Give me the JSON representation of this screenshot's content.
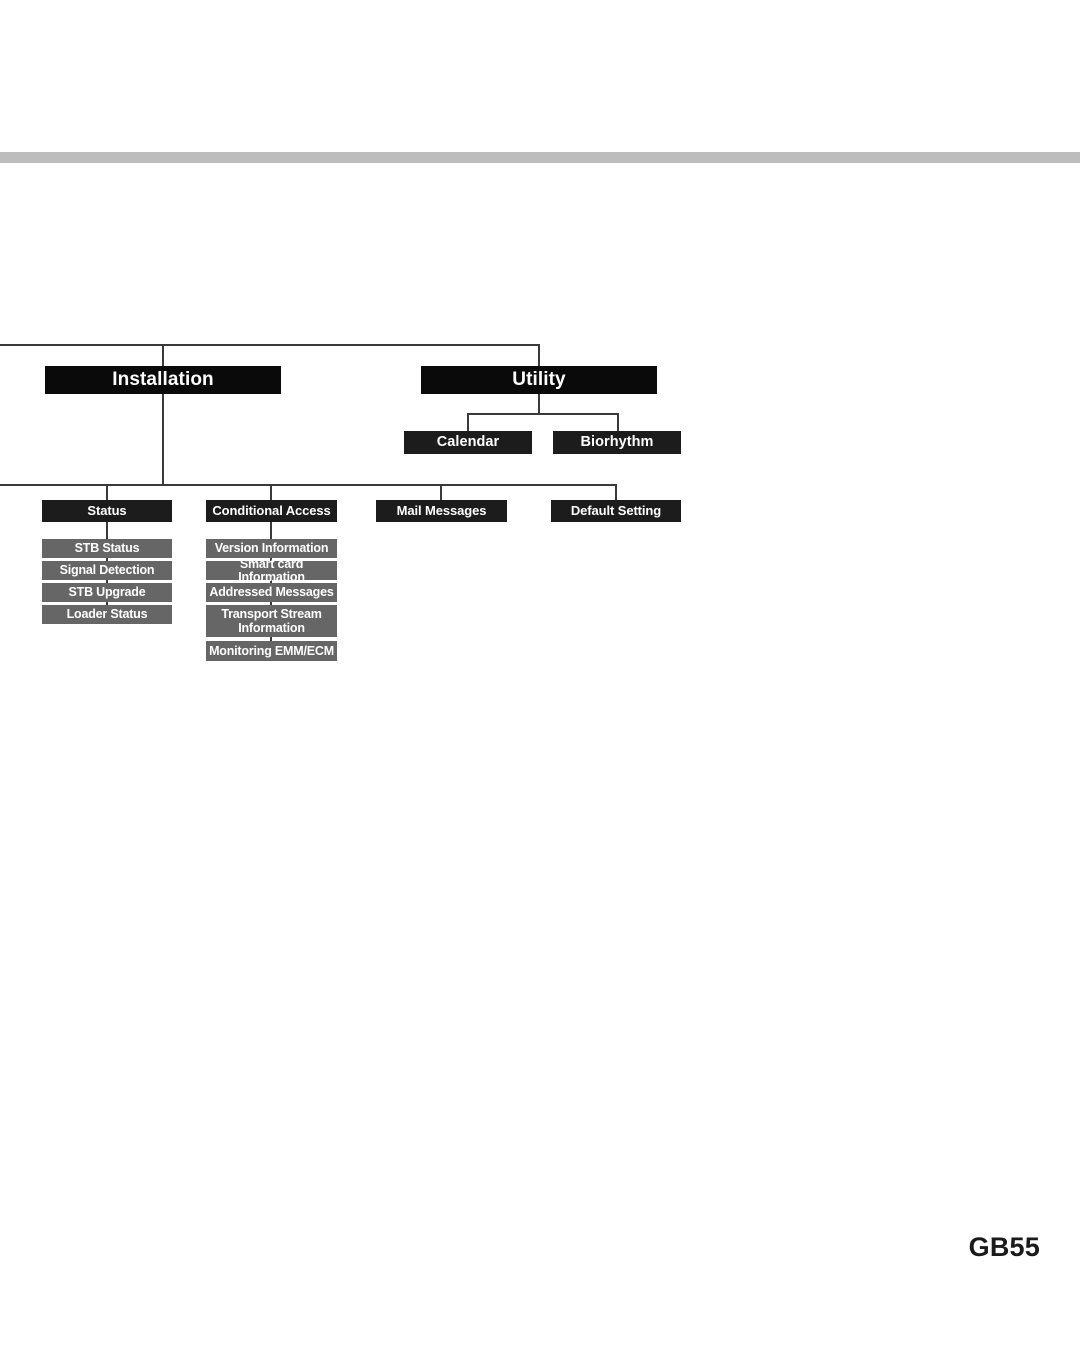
{
  "page": {
    "page_number": "GB55"
  },
  "diagram": {
    "type": "menu-tree",
    "colors": {
      "level1_box": "#0a0a0a",
      "sub_box": "#1c1c1c",
      "leaf_box": "#666666",
      "connector": "#3a3a3a",
      "header_rule": "#bdbdbd",
      "label_text": "#ffffff"
    },
    "nodes": {
      "installation": "Installation",
      "utility": "Utility",
      "calendar": "Calendar",
      "biorhythm": "Biorhythm",
      "status": "Status",
      "conditional_access": "Conditional Access",
      "mail_messages": "Mail Messages",
      "default_setting": "Default Setting",
      "status_children": [
        "STB Status",
        "Signal Detection",
        "STB Upgrade",
        "Loader Status"
      ],
      "conditional_access_children": [
        "Version Information",
        "Smart card Information",
        "Addressed Messages",
        "Transport Stream Information",
        "Monitoring EMM/ECM"
      ]
    }
  }
}
